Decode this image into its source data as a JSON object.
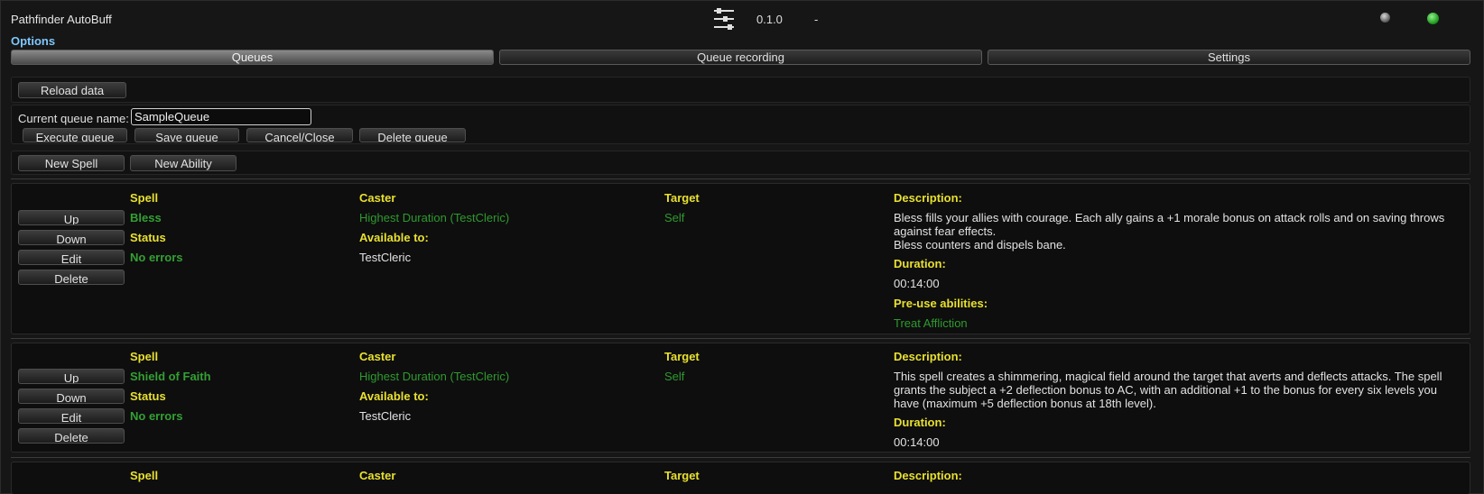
{
  "window": {
    "title": "Pathfinder AutoBuff",
    "version": "0.1.0",
    "separator": "-"
  },
  "options_label": "Options",
  "tabs": [
    {
      "label": "Queues",
      "active": true
    },
    {
      "label": "Queue recording",
      "active": false
    },
    {
      "label": "Settings",
      "active": false
    }
  ],
  "toolbar": {
    "reload_label": "Reload data"
  },
  "queue": {
    "name_label": "Current queue name:",
    "name_value": "SampleQueue",
    "execute_label": "Execute queue",
    "save_label": "Save queue",
    "cancel_label": "Cancel/Close",
    "delete_label": "Delete queue"
  },
  "new_buttons": {
    "new_spell": "New Spell",
    "new_ability": "New Ability"
  },
  "headers": {
    "spell": "Spell",
    "caster": "Caster",
    "target": "Target",
    "description": "Description:",
    "status": "Status",
    "available_to": "Available to:",
    "duration": "Duration:",
    "pre_use": "Pre-use abilities:"
  },
  "row_buttons": {
    "up": "Up",
    "down": "Down",
    "edit": "Edit",
    "delete": "Delete"
  },
  "entries": [
    {
      "spell": "Bless",
      "caster": "Highest Duration (TestCleric)",
      "target": "Self",
      "status": "No errors",
      "available_to": "TestCleric",
      "description_lines": [
        "Bless fills your allies with courage. Each ally gains a +1 morale bonus on attack rolls and on saving throws against fear effects.",
        "Bless counters and dispels bane."
      ],
      "duration": "00:14:00",
      "pre_use": "Treat Affliction"
    },
    {
      "spell": "Shield of Faith",
      "caster": "Highest Duration (TestCleric)",
      "target": "Self",
      "status": "No errors",
      "available_to": "TestCleric",
      "description_lines": [
        "This spell creates a shimmering, magical field around the target that averts and deflects attacks. The spell grants the subject a +2 deflection bonus to AC, with an additional +1 to the bonus for every six levels you have (maximum +5 deflection bonus at 18th level)."
      ],
      "duration": "00:14:00"
    }
  ],
  "colors": {
    "header_yellow": "#e8e030",
    "value_green": "#2f9a2f",
    "options_blue": "#7ec8ff",
    "status_dot": "#2db42d"
  },
  "icons": [
    "sliders-icon",
    "minimize-icon",
    "status-dot-icon"
  ]
}
